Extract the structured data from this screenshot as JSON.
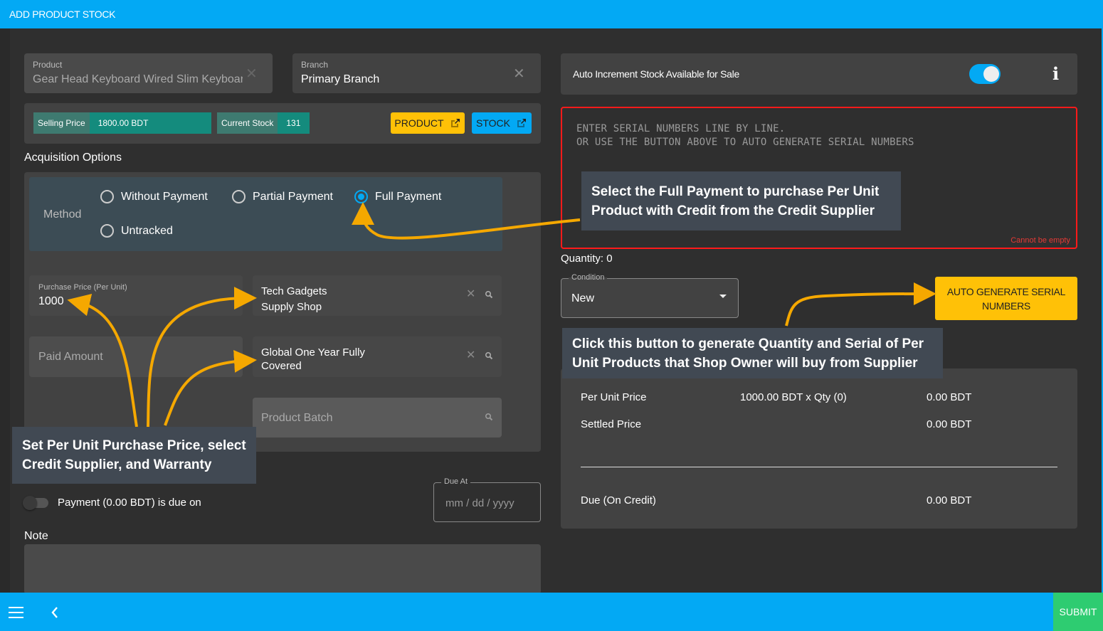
{
  "header": {
    "title": "ADD PRODUCT STOCK"
  },
  "product_field": {
    "label": "Product",
    "value": "Gear Head Keyboard Wired Slim Keyboar"
  },
  "branch_field": {
    "label": "Branch",
    "value": "Primary Branch"
  },
  "info_chips": {
    "selling_price": {
      "label": "Selling Price",
      "value": "1800.00 BDT"
    },
    "current_stock": {
      "label": "Current Stock",
      "value": "131"
    }
  },
  "link_buttons": {
    "product": "PRODUCT",
    "stock": "STOCK"
  },
  "acquisition": {
    "section_label": "Acquisition Options",
    "method_label": "Method",
    "options": [
      {
        "label": "Without Payment",
        "checked": false
      },
      {
        "label": "Partial Payment",
        "checked": false
      },
      {
        "label": "Full Payment",
        "checked": true
      },
      {
        "label": "Untracked",
        "checked": false
      }
    ]
  },
  "purchase_price": {
    "label": "Purchase Price (Per Unit)",
    "value": "1000"
  },
  "supplier": {
    "value_line1": "Tech Gadgets",
    "value_line2": "Supply Shop"
  },
  "paid_amount": {
    "placeholder": "Paid Amount"
  },
  "warranty": {
    "value_line1": "Global One Year Fully",
    "value_line2": "Covered"
  },
  "product_batch": {
    "placeholder": "Product Batch"
  },
  "payment_due": {
    "label": "Payment (0.00 BDT) is due on",
    "enabled": false
  },
  "due_at": {
    "legend": "Due At",
    "placeholder": "mm / dd / yyyy"
  },
  "note": {
    "label": "Note"
  },
  "auto_increment": {
    "label": "Auto Increment Stock Available for Sale",
    "enabled": true,
    "info_icon": "i"
  },
  "serials": {
    "placeholder_line1": "ENTER SERIAL NUMBERS LINE BY LINE.",
    "placeholder_line2": "OR USE THE BUTTON ABOVE TO AUTO GENERATE SERIAL NUMBERS",
    "error": "Cannot be empty"
  },
  "quantity": {
    "label": "Quantity: 0"
  },
  "condition": {
    "legend": "Condition",
    "value": "New"
  },
  "auto_generate_button": {
    "line1": "AUTO GENERATE SERIAL",
    "line2": "NUMBERS"
  },
  "summary": {
    "per_unit_price": {
      "label": "Per Unit Price",
      "calc": "1000.00 BDT x Qty (0)",
      "amount": "0.00 BDT"
    },
    "settled_price": {
      "label": "Settled Price",
      "amount": "0.00 BDT"
    },
    "due_on_credit": {
      "label": "Due (On Credit)",
      "amount": "0.00 BDT"
    }
  },
  "callouts": {
    "full_payment": {
      "line1": "Select the Full Payment to purchase Per Unit",
      "line2": "Product with Credit from the Credit Supplier"
    },
    "auto_generate": {
      "line1": "Click this button to generate Quantity and Serial of Per",
      "line2": "Unit Products that Shop Owner will buy from Supplier"
    },
    "purchase_info": {
      "line1": "Set Per Unit Purchase Price, select",
      "line2": "Credit Supplier, and Warranty"
    }
  },
  "footer": {
    "submit_label": "SUBMIT"
  },
  "colors": {
    "accent": "#03a9f4",
    "warning": "#ffc107",
    "success": "#2ecc71",
    "error": "#ff1a1a",
    "teal": "#148b7d",
    "annotation_arrow": "#f5a800"
  }
}
